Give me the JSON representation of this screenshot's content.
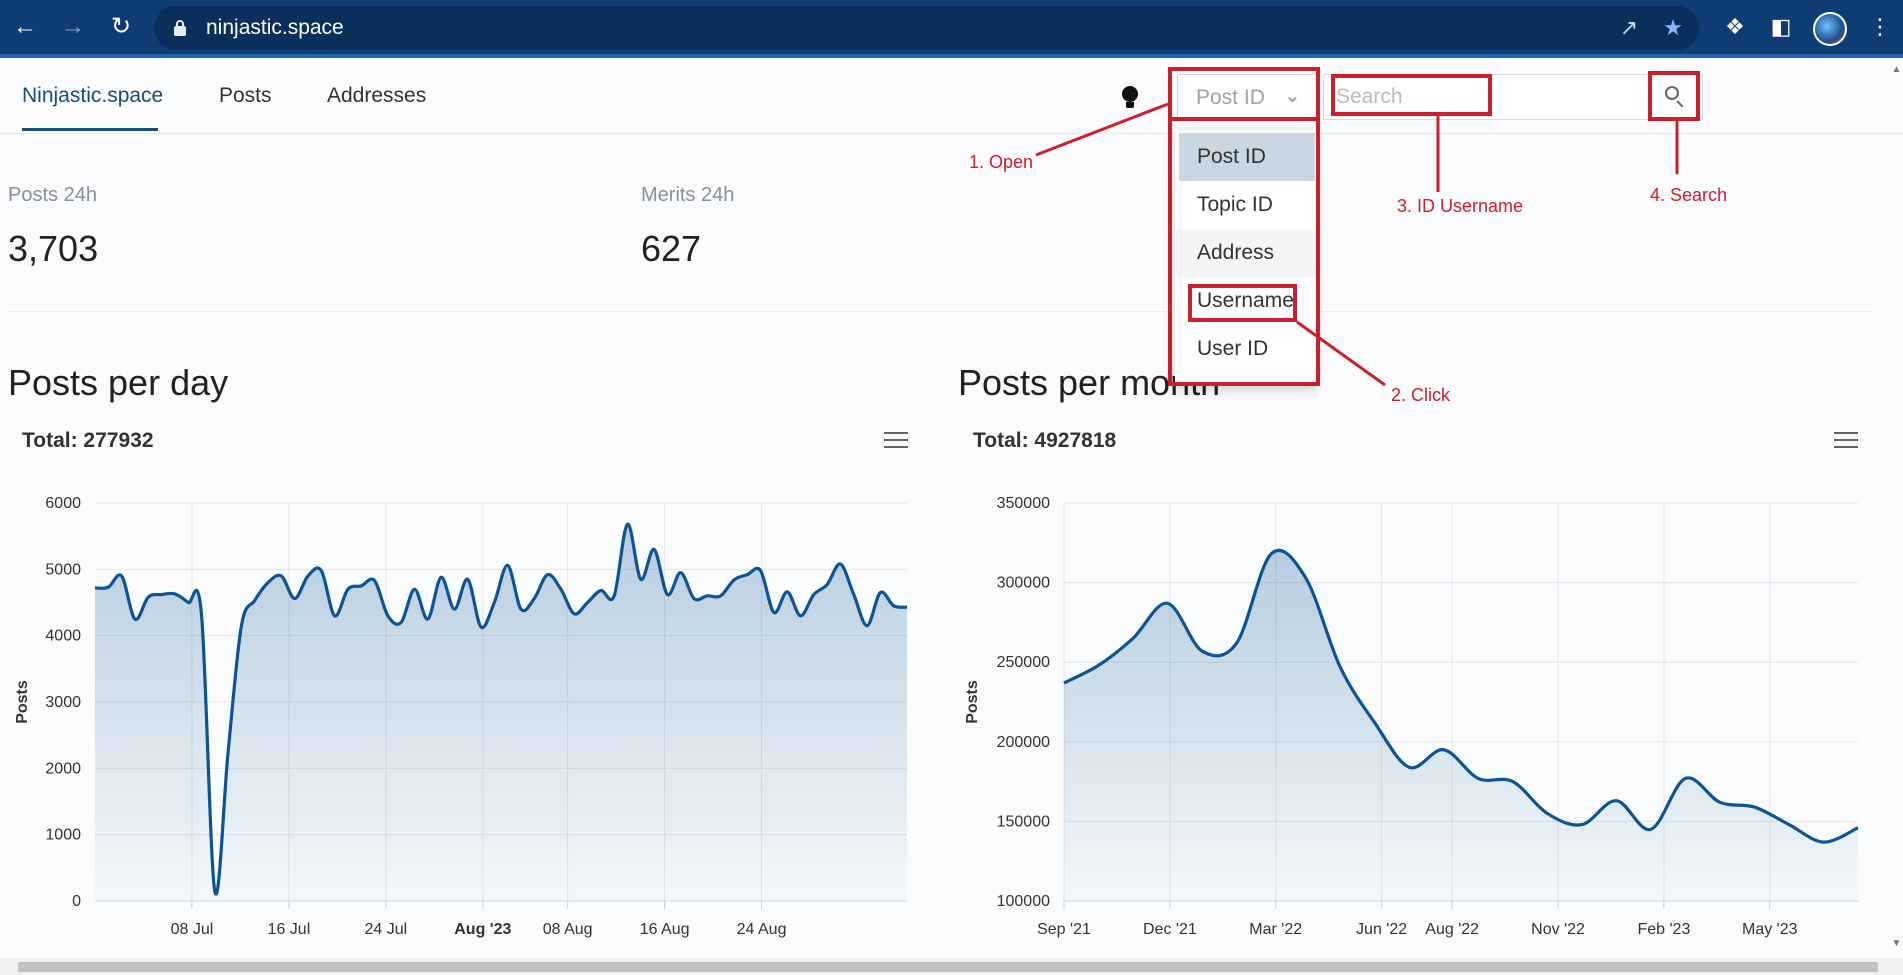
{
  "browser": {
    "url": "ninjastic.space"
  },
  "nav": {
    "brand": "Ninjastic.space",
    "posts": "Posts",
    "addresses": "Addresses"
  },
  "search": {
    "selected_type": "Post ID",
    "placeholder": "Search",
    "options": [
      "Post ID",
      "Topic ID",
      "Address",
      "Username",
      "User ID"
    ]
  },
  "stats": [
    {
      "label": "Posts 24h",
      "value": "3,703"
    },
    {
      "label": "Merits 24h",
      "value": "627"
    }
  ],
  "annotations": {
    "step1": "1. Open",
    "step2": "2. Click",
    "step3": "3. ID Username",
    "step4": "4. Search",
    "color": "#cc1f2b"
  },
  "charts": {
    "left_heading": "Posts per day",
    "right_heading": "Posts per month"
  },
  "chart_data": [
    {
      "type": "area",
      "title": "Total: 277932",
      "ylabel": "Posts",
      "xlabel": "",
      "ylim": [
        0,
        6000
      ],
      "y_ticks": [
        "0",
        "1000",
        "2000",
        "3000",
        "4000",
        "5000",
        "6000"
      ],
      "x_ticks": [
        "08 Jul",
        "16 Jul",
        "24 Jul",
        "Aug '23",
        "08 Aug",
        "16 Aug",
        "24 Aug"
      ],
      "x_tick_days": [
        8,
        16,
        24,
        32,
        39,
        47,
        55
      ],
      "x_start_day": 0,
      "x_end_day": 67,
      "series_color": "#0b5596",
      "values": [
        4720,
        4730,
        4900,
        4250,
        4580,
        4620,
        4630,
        4500,
        4320,
        150,
        2250,
        4150,
        4530,
        4800,
        4900,
        4560,
        4900,
        4980,
        4300,
        4700,
        4750,
        4830,
        4300,
        4200,
        4700,
        4250,
        4880,
        4400,
        4850,
        4130,
        4500,
        5060,
        4400,
        4560,
        4920,
        4700,
        4330,
        4500,
        4680,
        4600,
        5680,
        4850,
        5300,
        4620,
        4950,
        4560,
        4600,
        4600,
        4840,
        4920,
        4980,
        4350,
        4660,
        4300,
        4620,
        4770,
        5080,
        4620,
        4150,
        4650,
        4450,
        4430
      ]
    },
    {
      "type": "area",
      "title": "Total: 4927818",
      "ylabel": "Posts",
      "xlabel": "",
      "ylim": [
        100000,
        350000
      ],
      "y_ticks": [
        "100000",
        "150000",
        "200000",
        "250000",
        "300000",
        "350000"
      ],
      "x_ticks": [
        "Sep '21",
        "Dec '21",
        "Mar '22",
        "Jun '22",
        "Aug '22",
        "Nov '22",
        "Feb '23",
        "May '23"
      ],
      "x_tick_months": [
        0,
        3,
        6,
        9,
        11,
        14,
        17,
        20
      ],
      "x_end_month": 22.5,
      "series_color": "#0b5596",
      "values": [
        237000,
        248000,
        265000,
        287000,
        257000,
        262000,
        318000,
        303000,
        247000,
        212000,
        184000,
        195000,
        177000,
        175000,
        155000,
        148000,
        163000,
        145000,
        177000,
        162000,
        159000,
        148000,
        137000,
        146000
      ]
    }
  ]
}
